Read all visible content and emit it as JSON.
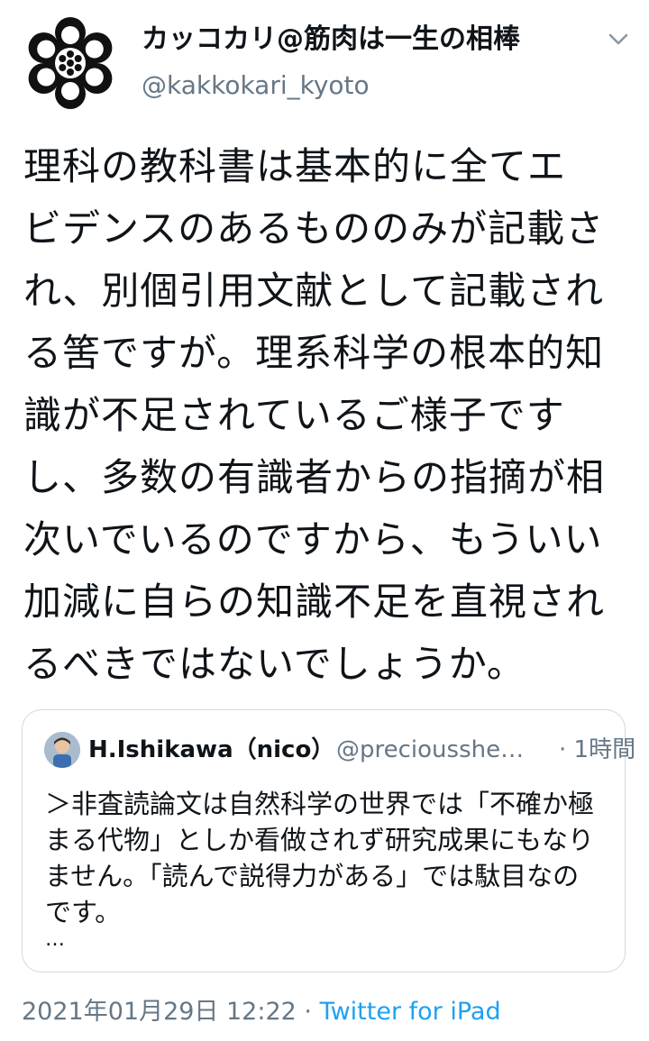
{
  "author": {
    "display_name": "カッコカリ@筋肉は一生の相棒",
    "handle": "@kakkokari_kyoto",
    "avatar_icon": "kyoto-crest-icon"
  },
  "menu": {
    "icon": "chevron-down-icon"
  },
  "tweet": {
    "text": "理科の教科書は基本的に全てエ\nビデンスのあるもののみが記載さ\nれ、別個引用文献として記載され\nる筈ですが。理系科学の根本的知\n識が不足されているご様子です\nし、多数の有識者からの指摘が相\n次いでいるのですから、もういい\n加減に自らの知識不足を直視され\nるべきではないでしょうか。"
  },
  "quoted_tweet": {
    "display_name": "H.Ishikawa（nico）",
    "handle": "@preciousshe…",
    "time": "· 1時間",
    "text": "＞非査読論文は自然科学の世界では「不確か極\nまる代物」としか看做されず研究成果にもなり\nません。「読んで説得力がある」では駄目なの\nです。",
    "ellipsis": "…"
  },
  "footer": {
    "timestamp": "2021年01月29日 12:22 · ",
    "source": "Twitter for iPad"
  },
  "colors": {
    "text": "#0f1419",
    "secondary": "#657786",
    "link": "#1da1f2",
    "border": "#cfd9de"
  }
}
